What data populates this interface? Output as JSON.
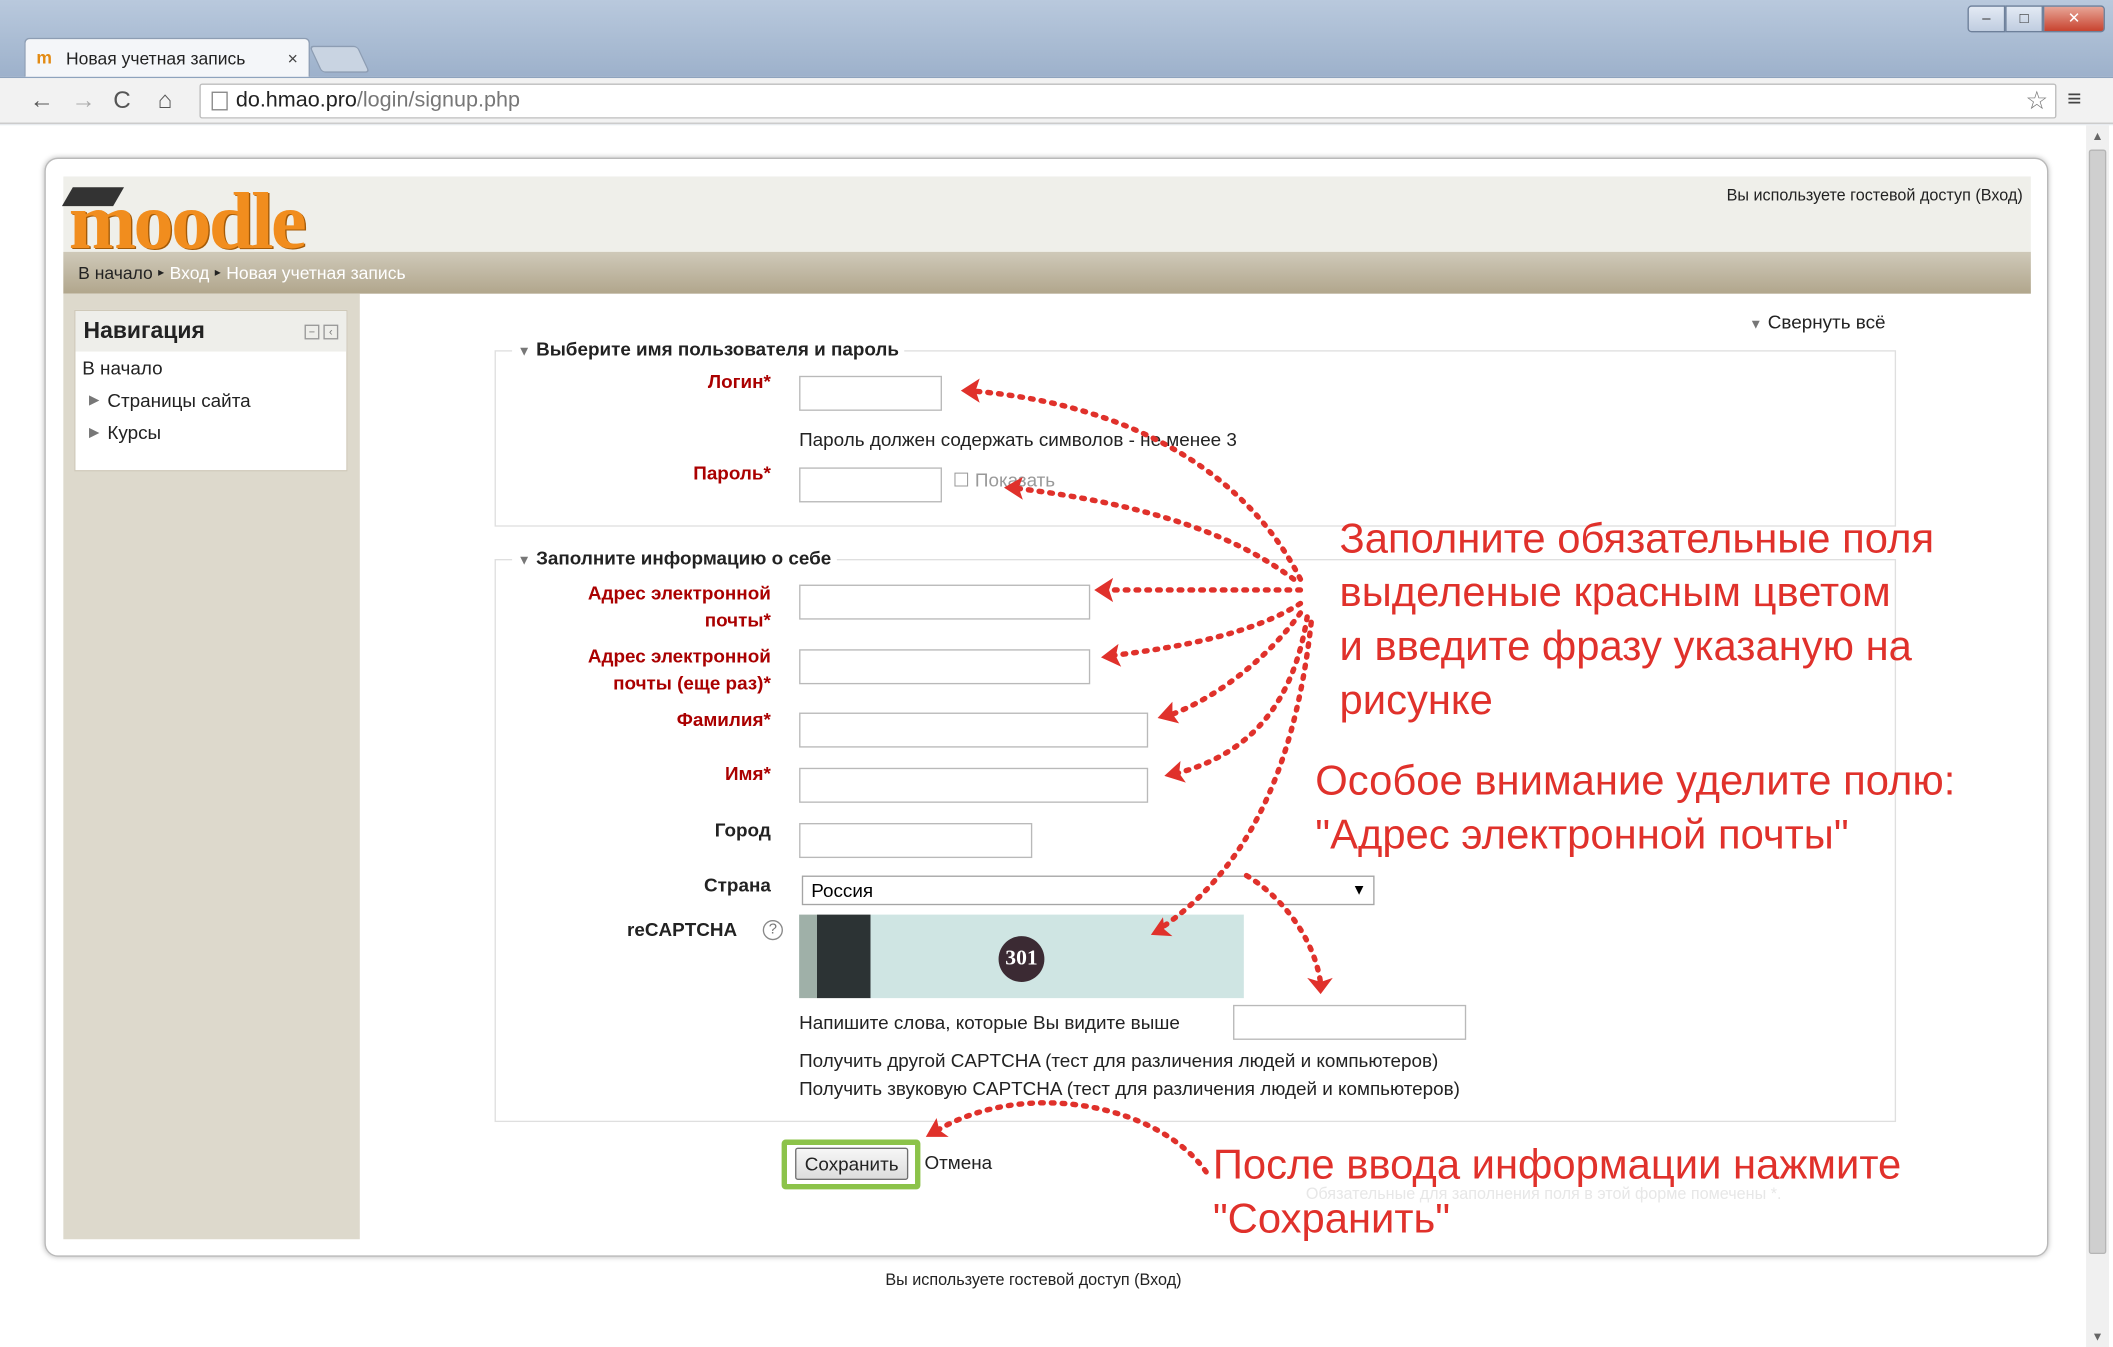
{
  "browser": {
    "tab_title": "Новая учетная запись",
    "tab_close": "×",
    "url_host": "do.hmao.pro",
    "url_path": "/login/signup.php"
  },
  "header": {
    "logo": "moodle",
    "login_info": "Вы используете гостевой доступ (Вход)",
    "breadcrumb": {
      "home": "В начало",
      "sep": "▸",
      "login": "Вход",
      "current": "Новая учетная запись"
    }
  },
  "navigation": {
    "title": "Навигация",
    "items": [
      "В начало",
      "Страницы сайта",
      "Курсы"
    ]
  },
  "form": {
    "collapse_all": "Свернуть всё",
    "section1_legend": "Выберите имя пользователя и пароль",
    "login_label": "Логин",
    "password_hint": "Пароль должен содержать символов - не менее 3",
    "password_label": "Пароль",
    "show_label": "Показать",
    "section2_legend": "Заполните информацию о себе",
    "email_label_1": "Адрес электронной",
    "email_label_2": "почты",
    "email2_label_1": "Адрес электронной",
    "email2_label_2": "почты (еще раз)",
    "surname_label": "Фамилия",
    "name_label": "Имя",
    "city_label": "Город",
    "country_label": "Страна",
    "country_value": "Россия",
    "captcha_label": "reCAPTCHA",
    "captcha_code": "301",
    "captcha_prompt": "Напишите слова, которые Вы видите выше",
    "captcha_other": "Получить другой CAPTCHA (тест для различения людей и компьютеров)",
    "captcha_audio": "Получить звуковую CAPTCHA (тест для различения людей и компьютеров)",
    "required_star": "*",
    "save_button": "Сохранить",
    "cancel_button": "Отмена",
    "required_note": "Обязательные для заполнения поля в этой форме помечены *."
  },
  "footer": {
    "login_info": "Вы используете гостевой доступ (Вход)"
  },
  "annotations": {
    "fill_line1": "Заполните обязательные поля",
    "fill_line2": "выделеные красным цветом",
    "fill_line3": "и введите фразу указаную на",
    "fill_line4": "рисунке",
    "attention_line1": "Особое внимание уделите полю:",
    "attention_line2": "\"Адрес электронной почты\"",
    "save_line1": "После ввода информации нажмите",
    "save_line2": "\"Сохранить\"",
    "color": "#e0312b"
  }
}
